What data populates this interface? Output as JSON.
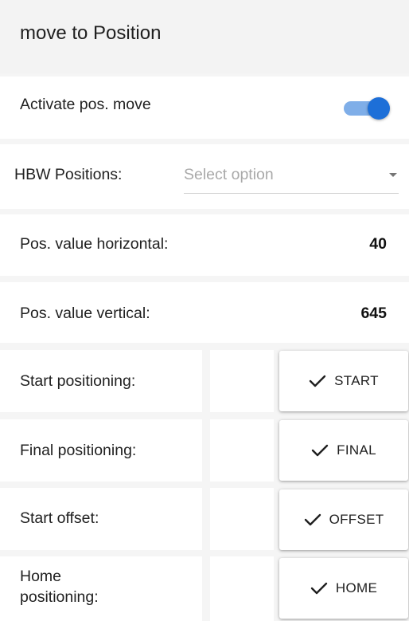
{
  "header": {
    "title": "move to Position"
  },
  "activate": {
    "label": "Activate pos. move",
    "toggle_on": true
  },
  "positions": {
    "label": "HBW Positions:",
    "placeholder": "Select option"
  },
  "horizontal": {
    "label": "Pos. value horizontal:",
    "value": "40"
  },
  "vertical": {
    "label": "Pos. value vertical:",
    "value": "645"
  },
  "actions": [
    {
      "label": "Start positioning:",
      "button": "START",
      "icon": "checkmark-icon"
    },
    {
      "label": "Final positioning:",
      "button": "FINAL",
      "icon": "checkmark-icon"
    },
    {
      "label": "Start offset:",
      "button": "OFFSET",
      "icon": "checkmark-icon"
    },
    {
      "label_line1": "Home",
      "label_line2": "positioning:",
      "button": "HOME",
      "icon": "checkmark-icon"
    }
  ],
  "colors": {
    "accent": "#1d6fd8",
    "accent_track": "#7faee8",
    "header_bg": "#f3f3f3"
  }
}
